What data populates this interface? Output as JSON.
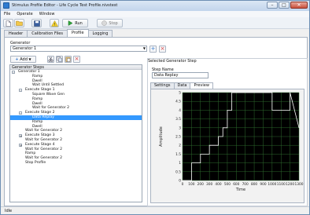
{
  "window": {
    "title": "Stimulus Profile Editor - Life Cycle Test Profile.nivstest",
    "minimize": "–",
    "maximize": "□",
    "close": "✕"
  },
  "menu": [
    "File",
    "Operate",
    "Window"
  ],
  "toolbar": {
    "run_label": "Run",
    "stop_label": "Stop"
  },
  "tabs": [
    "Header",
    "Calibration Files",
    "Profile",
    "Logging"
  ],
  "active_tab": "Profile",
  "generator": {
    "label": "Generator",
    "value": "Generator 1"
  },
  "step_toolbar": {
    "add_label": "Add"
  },
  "tree": {
    "header": "Generator Steps",
    "rows": [
      {
        "text": "Generator 1",
        "level": 0,
        "expander": "-"
      },
      {
        "text": "Ramp",
        "level": 2
      },
      {
        "text": "Dwell",
        "level": 2
      },
      {
        "text": "Wait Until Settled",
        "level": 2
      },
      {
        "text": "Execute Stage 1",
        "level": 1,
        "expander": "-"
      },
      {
        "text": "Square Wave Gen",
        "level": 2
      },
      {
        "text": "Ramp",
        "level": 2
      },
      {
        "text": "Dwell",
        "level": 2
      },
      {
        "text": "Wait for Generator 2",
        "level": 2
      },
      {
        "text": "Execute Stage 2",
        "level": 1,
        "expander": "-"
      },
      {
        "text": "Data Replay",
        "level": 2,
        "selected": true
      },
      {
        "text": "Ramp",
        "level": 2
      },
      {
        "text": "Dwell",
        "level": 2
      },
      {
        "text": "Wait for Generator 2",
        "level": 1
      },
      {
        "text": "Execute Stage 3",
        "level": 1,
        "expander": "+"
      },
      {
        "text": "Wait for Generator 2",
        "level": 1
      },
      {
        "text": "Execute Stage 4",
        "level": 1,
        "expander": "+"
      },
      {
        "text": "Wait for Generator 2",
        "level": 1
      },
      {
        "text": "Ramp",
        "level": 1
      },
      {
        "text": "Wait for Generator 2",
        "level": 1
      },
      {
        "text": "Stop Profile",
        "level": 1
      }
    ]
  },
  "selected_step": {
    "section_label": "Selected Generator Step",
    "name_label": "Step Name",
    "name_value": "Data Replay",
    "tabs": [
      "Settings",
      "Data",
      "Preview"
    ],
    "active_tab": "Preview"
  },
  "chart_data": {
    "type": "line",
    "title": "",
    "xlabel": "Time",
    "ylabel": "Amplitude",
    "xlim": [
      0,
      1300
    ],
    "ylim": [
      0,
      5
    ],
    "x_ticks": [
      "0",
      "100",
      "200",
      "300",
      "400",
      "500",
      "600",
      "700",
      "800",
      "900",
      "1000",
      "1100",
      "1200",
      "1300"
    ],
    "y_ticks": [
      "0",
      "0.5",
      "1",
      "1.5",
      "2",
      "2.5",
      "3",
      "3.5",
      "4",
      "4.5",
      "5"
    ],
    "grid": true,
    "background": "#000000",
    "gridColor": "#2e6a2e",
    "lineColor": "#ffffff",
    "series": [
      {
        "x": [
          0,
          100,
          100,
          200,
          200,
          300,
          300,
          400,
          400,
          450,
          450,
          500,
          500,
          550,
          550,
          1000,
          1000,
          1200,
          1200,
          1300
        ],
        "y": [
          0,
          0,
          1,
          1,
          1.5,
          1.5,
          2,
          2,
          2.5,
          2.5,
          3,
          3,
          4,
          4,
          5,
          5,
          4,
          4,
          5,
          3
        ]
      }
    ]
  },
  "status": {
    "text": "Idle"
  },
  "colors": {
    "accent": "#3399ff",
    "title_gradient_top": "#dbe7f5"
  }
}
